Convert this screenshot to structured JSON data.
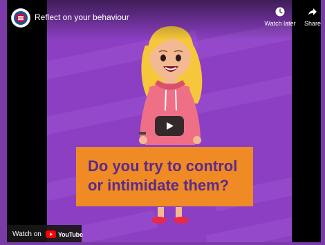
{
  "video": {
    "title": "Reflect on your behaviour",
    "channel_logo_icon": "police-crest-icon"
  },
  "actions": {
    "watch_later_label": "Watch later",
    "watch_later_icon": "clock-icon",
    "share_label": "Share",
    "share_icon": "share-arrow-icon"
  },
  "caption": {
    "line1": "Do you try to control",
    "line2": "or intimidate them?"
  },
  "controls": {
    "play_icon": "play-icon",
    "watch_on_label": "Watch on",
    "youtube_label": "YouTube"
  },
  "colors": {
    "frame": "#7a3aa8",
    "scene_bg": "#8c3fc3",
    "caption_bg": "#f08a24",
    "caption_text": "#5a2a8c",
    "youtube_red": "#ff0000"
  }
}
